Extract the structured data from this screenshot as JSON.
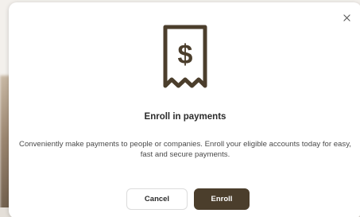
{
  "modal": {
    "title": "Enroll in payments",
    "description": "Conveniently make payments to people or companies. Enroll your eligible accounts today for easy, fast and secure payments.",
    "close_glyph": "×",
    "cancel_label": "Cancel",
    "enroll_label": "Enroll",
    "icon": "receipt-dollar-icon"
  },
  "colors": {
    "accent": "#4b3e2c",
    "text": "#2b2b2b",
    "muted_text": "#4a4a4a"
  }
}
